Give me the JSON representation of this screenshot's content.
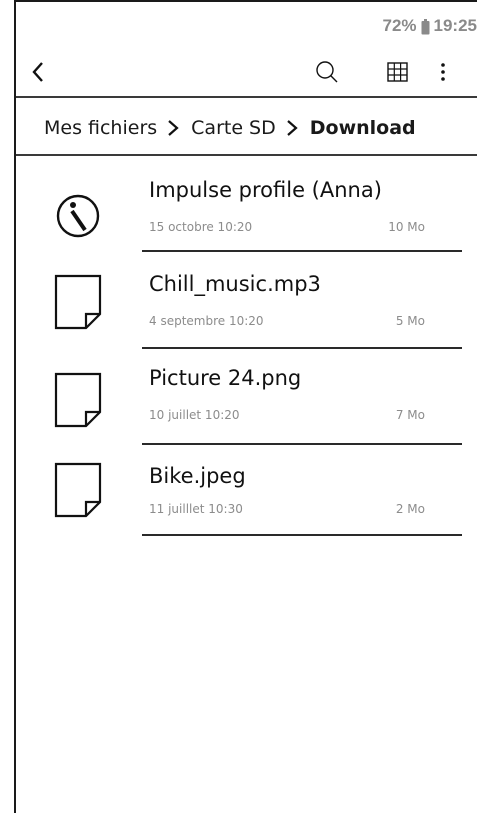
{
  "status_bar": {
    "battery": "72%",
    "time": "19:25"
  },
  "toolbar": {
    "back_icon": "chevron-left-icon",
    "search_icon": "search-icon",
    "grid_icon": "grid-view-icon",
    "more_icon": "more-vertical-icon"
  },
  "breadcrumb": {
    "items": [
      "Mes fichiers",
      "Carte SD",
      "Download"
    ],
    "separator_icon": "chevron-right-icon"
  },
  "files": [
    {
      "name": "Impulse profile (Anna)",
      "date": "15 octobre 10:20",
      "size": "10 Mo",
      "icon": "info-icon"
    },
    {
      "name": "Chill_music.mp3",
      "date": "4 septembre 10:20",
      "size": "5 Mo",
      "icon": "file-icon"
    },
    {
      "name": "Picture 24.png",
      "date": "10 juillet 10:20",
      "size": "7 Mo",
      "icon": "file-icon"
    },
    {
      "name": "Bike.jpeg",
      "date": "11 juilllet 10:30",
      "size": "2 Mo",
      "icon": "file-icon"
    }
  ]
}
